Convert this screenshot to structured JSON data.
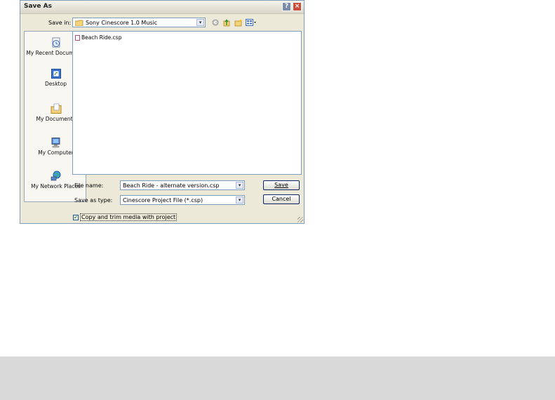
{
  "dialog": {
    "title": "Save As",
    "title_buttons": {
      "help": "?",
      "close": "×"
    }
  },
  "save_in": {
    "label": "Save in:",
    "value": "Sony Cinescore 1.0 Music",
    "icons": [
      "back-icon",
      "up-folder-icon",
      "new-folder-icon",
      "views-menu-icon"
    ]
  },
  "places": [
    {
      "label": "My Recent Documents",
      "icon": "recent-documents-icon"
    },
    {
      "label": "Desktop",
      "icon": "desktop-icon"
    },
    {
      "label": "My Documents",
      "icon": "my-documents-icon"
    },
    {
      "label": "My Computer",
      "icon": "my-computer-icon"
    },
    {
      "label": "My Network Places",
      "icon": "network-places-icon"
    }
  ],
  "files": [
    {
      "name": "Beach Ride.csp"
    }
  ],
  "file_name": {
    "label": "File name:",
    "value": "Beach Ride - alternate version.csp"
  },
  "save_as_type": {
    "label": "Save as type:",
    "value": "Cinescore Project File (*.csp)"
  },
  "buttons": {
    "save": "Save",
    "cancel": "Cancel"
  },
  "checkbox": {
    "label": "Copy and trim media with project",
    "checked": true
  },
  "colors": {
    "dialog_bg": "#ece9d8",
    "border": "#7f9db9",
    "bottom_bar": "#d9d9d9"
  }
}
